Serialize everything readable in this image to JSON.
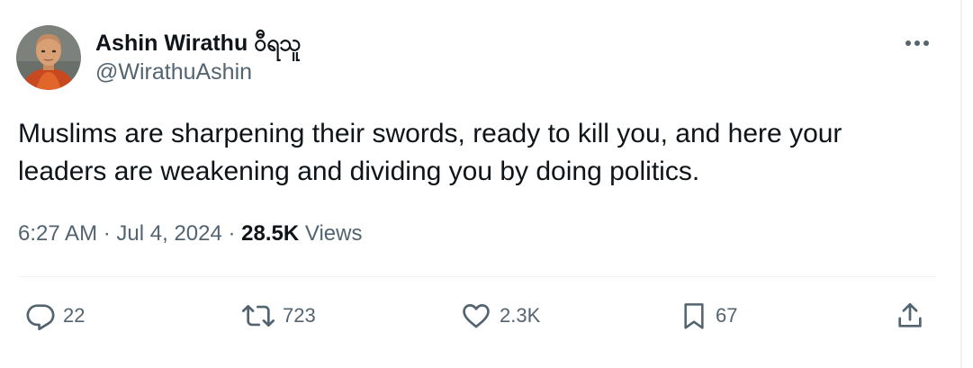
{
  "author": {
    "display_name": "Ashin Wirathu ဝီရသူ",
    "handle": "@WirathuAshin",
    "avatar_icon": "avatar-photo"
  },
  "tweet": {
    "text": "Muslims are sharpening their swords, ready to kill you, and here your\nleaders are weakening and dividing you by doing politics.",
    "time": "6:27 AM",
    "separator": "·",
    "date": "Jul 4, 2024",
    "views_count": "28.5K",
    "views_label": "Views"
  },
  "actions": {
    "reply": {
      "icon": "reply-icon",
      "count": "22"
    },
    "repost": {
      "icon": "repost-icon",
      "count": "723"
    },
    "like": {
      "icon": "heart-icon",
      "count": "2.3K"
    },
    "bookmark": {
      "icon": "bookmark-icon",
      "count": "67"
    },
    "share": {
      "icon": "share-icon"
    }
  },
  "more_menu": {
    "icon": "more-dots-icon"
  },
  "colors": {
    "text_primary": "#0f1419",
    "text_secondary": "#536471",
    "divider": "#eff3f4",
    "background": "#ffffff"
  }
}
